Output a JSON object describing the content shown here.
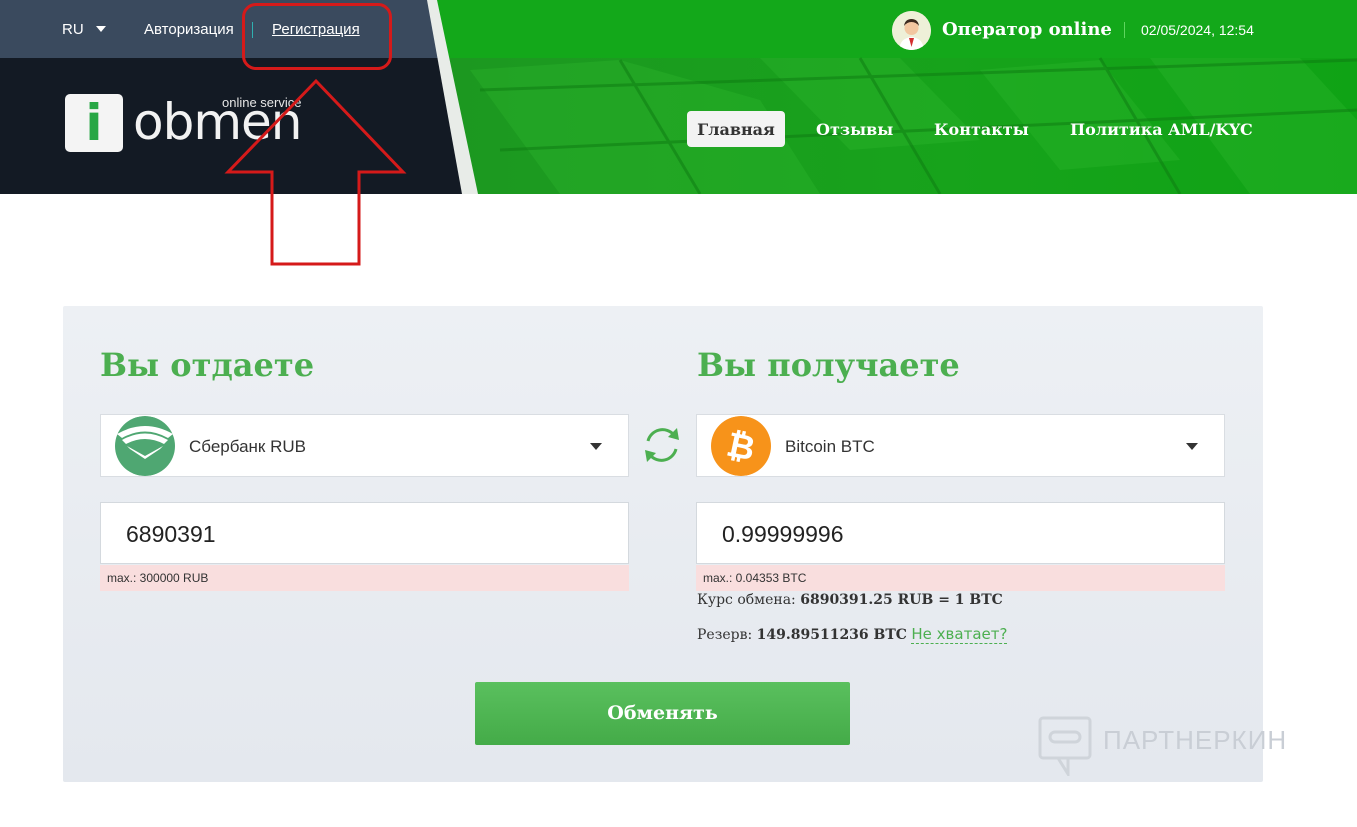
{
  "topbar": {
    "language": "RU",
    "login_label": "Авторизация",
    "register_label": "Регистрация",
    "operator_label": "Оператор online",
    "datetime": "02/05/2024, 12:54"
  },
  "logo": {
    "mark": "i",
    "word": "obmen",
    "tagline": "online service"
  },
  "nav": {
    "items": [
      {
        "label": "Главная",
        "active": true
      },
      {
        "label": "Отзывы",
        "active": false
      },
      {
        "label": "Контакты",
        "active": false
      },
      {
        "label": "Политика AML/KYC",
        "active": false
      }
    ]
  },
  "exchange": {
    "give": {
      "title": "Вы отдаете",
      "currency": "Сбербанк RUB",
      "currency_icon": "sberbank-icon",
      "amount": "6890391",
      "limit": "max.: 300000 RUB"
    },
    "get": {
      "title": "Вы получаете",
      "currency": "Bitcoin BTC",
      "currency_icon": "bitcoin-icon",
      "amount": "0.99999996",
      "limit": "max.: 0.04353 BTC"
    },
    "rate_label": "Курс обмена:",
    "rate_value": "6890391.25 RUB = 1 BTC",
    "reserve_label": "Резерв:",
    "reserve_value": "149.89511236 BTC",
    "not_enough_link": "Не хватает?",
    "submit_label": "Обменять"
  },
  "watermark": {
    "text": "ПАРТНЕРКИН"
  },
  "colors": {
    "accent_green": "#4caf50",
    "header_green": "#17a31b",
    "header_dark": "#131a24",
    "annotation_red": "#d51a1a",
    "limit_bg": "#f9dede"
  }
}
